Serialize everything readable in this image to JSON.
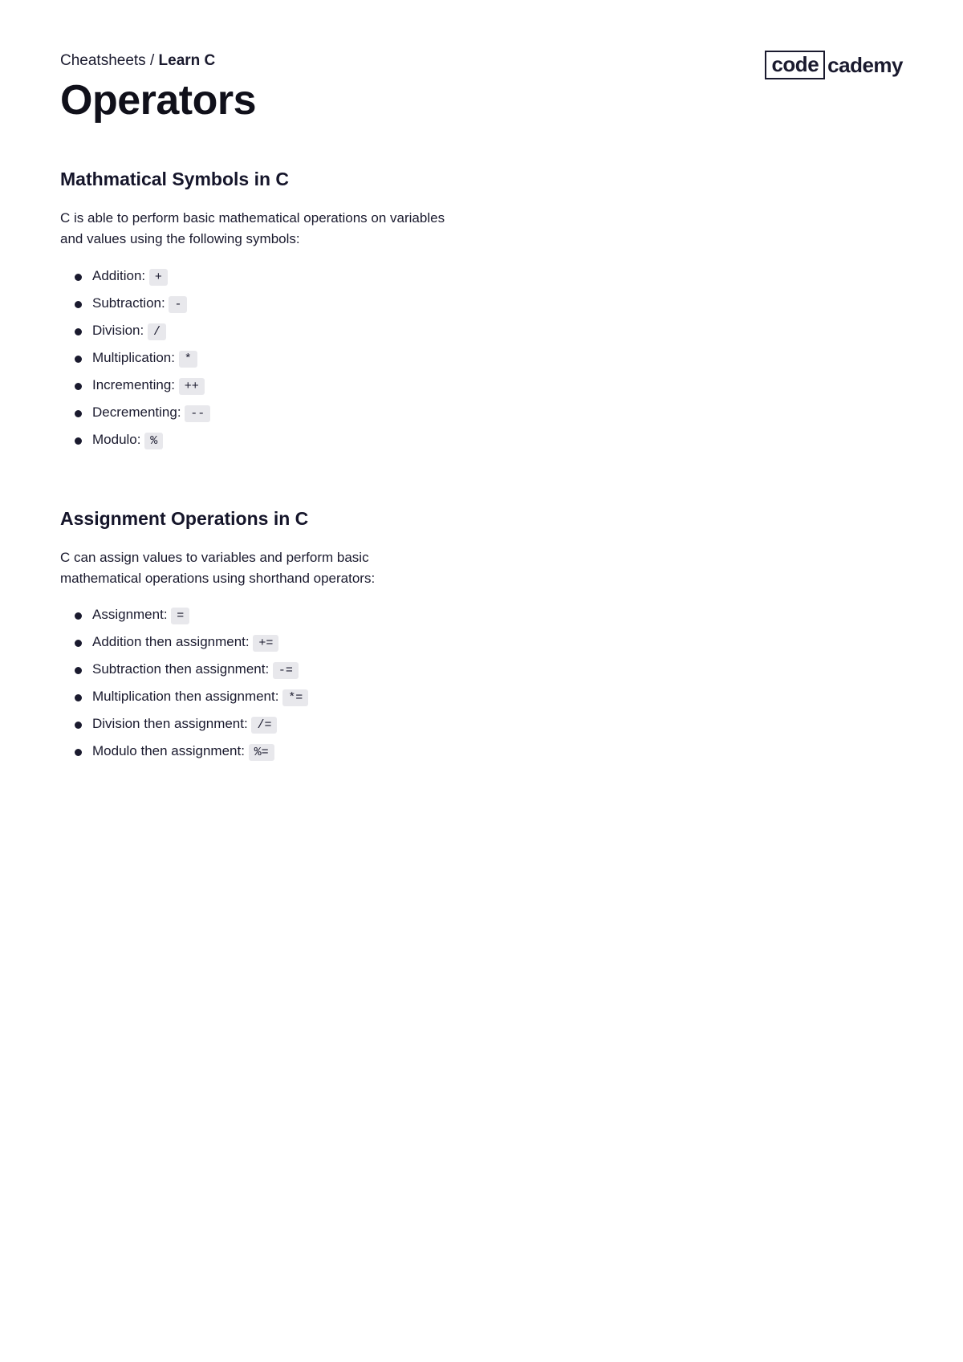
{
  "breadcrumb": {
    "prefix": "Cheatsheets / ",
    "current": "Learn C"
  },
  "page_title": "Operators",
  "logo": {
    "box": "code",
    "text": "cademy"
  },
  "sections": [
    {
      "title": "Mathmatical Symbols in C",
      "desc": "C is able to perform basic mathematical operations on variables and values using the following symbols:",
      "items": [
        {
          "label": "Addition: ",
          "code": "+"
        },
        {
          "label": "Subtraction: ",
          "code": "-"
        },
        {
          "label": "Division: ",
          "code": "/"
        },
        {
          "label": "Multiplication: ",
          "code": "*"
        },
        {
          "label": "Incrementing: ",
          "code": "++"
        },
        {
          "label": "Decrementing: ",
          "code": "--"
        },
        {
          "label": "Modulo: ",
          "code": "%"
        }
      ]
    },
    {
      "title": "Assignment Operations in C",
      "desc": "C can assign values to variables and perform basic mathematical operations using shorthand operators:",
      "items": [
        {
          "label": "Assignment: ",
          "code": "="
        },
        {
          "label": "Addition then assignment: ",
          "code": "+="
        },
        {
          "label": "Subtraction then assignment: ",
          "code": "-="
        },
        {
          "label": "Multiplication then assignment: ",
          "code": "*="
        },
        {
          "label": "Division then assignment: ",
          "code": "/="
        },
        {
          "label": "Modulo then assignment: ",
          "code": "%="
        }
      ]
    }
  ]
}
